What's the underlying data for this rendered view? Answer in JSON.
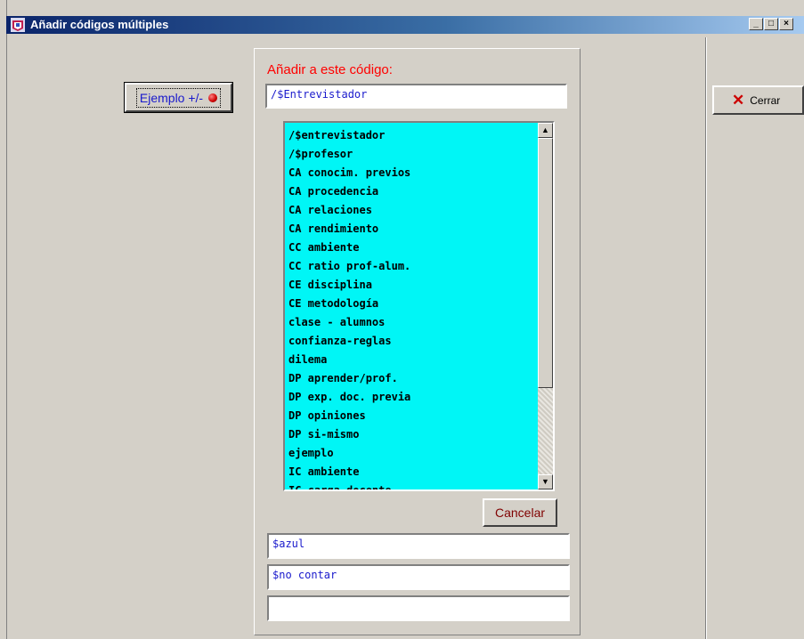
{
  "window": {
    "title": "Añadir códigos múltiples",
    "controls": {
      "minimize": "_",
      "maximize": "□",
      "close": "×"
    }
  },
  "sidebar": {
    "ejemplo_label": "Ejemplo +/-"
  },
  "main": {
    "heading": "Añadir a este código:",
    "target_code_value": "/$Entrevistador",
    "codes_list": [
      "/$entrevistador",
      "/$profesor",
      "CA conocim. previos",
      "CA procedencia",
      "CA relaciones",
      "CA rendimiento",
      "CC ambiente",
      "CC ratio prof-alum.",
      "CE disciplina",
      "CE metodología",
      "clase - alumnos",
      "confianza-reglas",
      "dilema",
      "DP aprender/prof.",
      "DP exp. doc. previa",
      "DP opiniones",
      "DP si-mismo",
      "ejemplo",
      "IC ambiente",
      "IC carga docente"
    ],
    "cancel_label": "Cancelar",
    "extra_fields": [
      "$azul",
      "$no contar",
      ""
    ]
  },
  "right_panel": {
    "close_label": "Cerrar"
  },
  "colors": {
    "list_background": "#00f6f6",
    "heading": "#ff0000",
    "field_text": "#1a1acc",
    "titlebar_start": "#0a246a",
    "titlebar_end": "#a6caf0"
  },
  "icons": {
    "app": "app-icon",
    "close_button": "red-x-icon",
    "ejemplo_button": "red-dot-icon"
  }
}
